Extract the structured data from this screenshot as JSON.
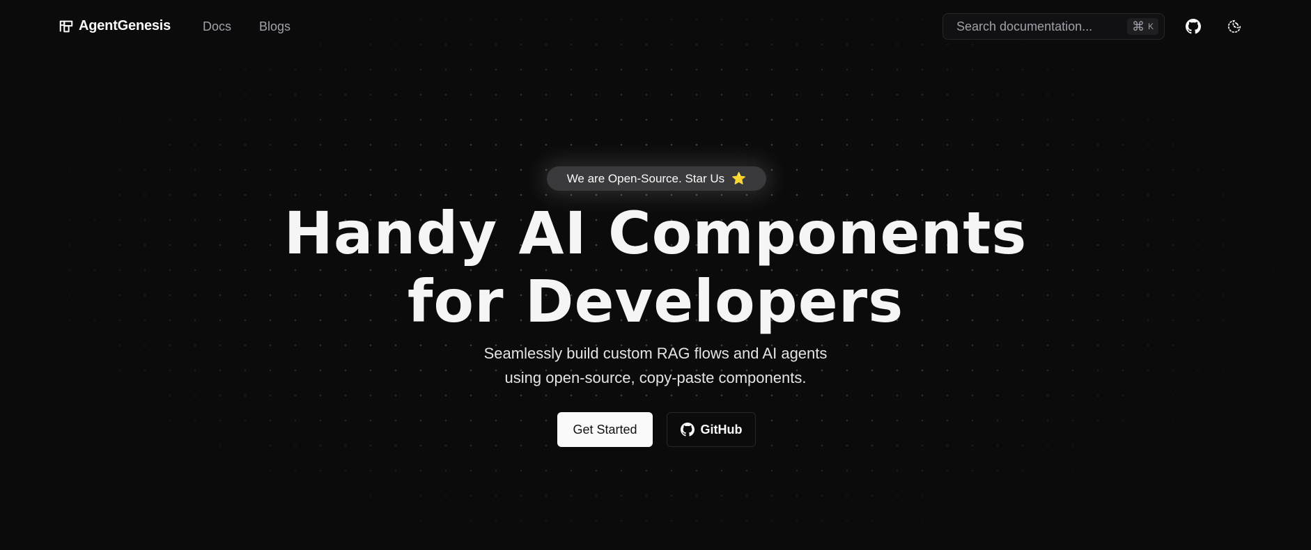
{
  "header": {
    "brand": "AgentGenesis",
    "nav": [
      {
        "label": "Docs"
      },
      {
        "label": "Blogs"
      }
    ],
    "search": {
      "placeholder": "Search documentation...",
      "shortcut_symbol": "⌘",
      "shortcut_key": "K"
    },
    "icons": {
      "github": "github-icon",
      "theme": "theme-toggle-icon"
    }
  },
  "hero": {
    "badge": {
      "text": "We are Open-Source. Star Us",
      "emoji": "⭐"
    },
    "headline": [
      "Handy AI Components",
      "for Developers"
    ],
    "subtitle": [
      "Seamlessly build custom RAG flows and AI agents",
      "using open-source, copy-paste components."
    ],
    "buttons": {
      "primary": "Get Started",
      "secondary": "GitHub"
    }
  },
  "colors": {
    "background": "#0b0b0c",
    "text": "#fafafa",
    "muted": "#a1a1aa",
    "border": "#27272a",
    "badge": "#3a3a3d",
    "star": "#facc15"
  }
}
